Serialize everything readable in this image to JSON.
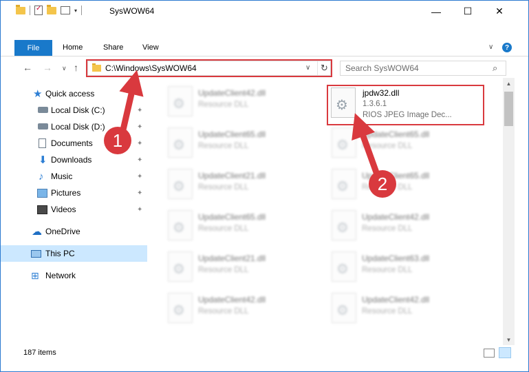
{
  "window": {
    "title": "SysWOW64",
    "controls": {
      "minimize": "—",
      "maximize": "☐",
      "close": "✕"
    }
  },
  "ribbon": {
    "tabs": [
      "File",
      "Home",
      "Share",
      "View"
    ],
    "expand_icon": "chevron-down-icon",
    "help_label": "?"
  },
  "navigation": {
    "back": "←",
    "forward": "→",
    "recent": "∨",
    "up": "↑",
    "address_path": "C:\\Windows\\SysWOW64",
    "refresh": "↻",
    "search_placeholder": "Search SysWOW64",
    "search_icon": "⌕"
  },
  "sidebar": {
    "items": [
      {
        "label": "Quick access",
        "icon": "star-icon",
        "pinned": false
      },
      {
        "label": "Local Disk (C:)",
        "icon": "drive-icon",
        "pinned": true
      },
      {
        "label": "Local Disk (D:)",
        "icon": "drive-icon",
        "pinned": true
      },
      {
        "label": "Documents",
        "icon": "documents-icon",
        "pinned": true
      },
      {
        "label": "Downloads",
        "icon": "download-icon",
        "pinned": true
      },
      {
        "label": "Music",
        "icon": "music-icon",
        "pinned": true
      },
      {
        "label": "Pictures",
        "icon": "pictures-icon",
        "pinned": true
      },
      {
        "label": "Videos",
        "icon": "videos-icon",
        "pinned": true
      },
      {
        "label": "OneDrive",
        "icon": "cloud-icon",
        "pinned": false
      },
      {
        "label": "This PC",
        "icon": "computer-icon",
        "pinned": false,
        "selected": true
      },
      {
        "label": "Network",
        "icon": "network-icon",
        "pinned": false
      }
    ],
    "pin_glyph": "📌"
  },
  "files": {
    "left_column": [
      {
        "name": "UpdateClient42.dll",
        "type": "Resource DLL"
      },
      {
        "name": "UpdateClient65.dll",
        "type": "Resource DLL"
      },
      {
        "name": "UpdateClient21.dll",
        "type": "Resource DLL"
      },
      {
        "name": "UpdateClient65.dll",
        "type": "Resource DLL"
      },
      {
        "name": "UpdateClient21.dll",
        "type": "Resource DLL"
      },
      {
        "name": "UpdateClient42.dll",
        "type": "Resource DLL"
      }
    ],
    "highlighted": {
      "name": "jpdw32.dll",
      "version": "1.3.6.1",
      "description": "RIOS JPEG Image Dec..."
    },
    "right_column": [
      {
        "name": "UpdateClient65.dll",
        "type": "Resource DLL"
      },
      {
        "name": "UpdateClient65.dll",
        "type": "Resource DLL"
      },
      {
        "name": "UpdateClient42.dll",
        "type": "Resource DLL"
      },
      {
        "name": "UpdateClient63.dll",
        "type": "Resource DLL"
      },
      {
        "name": "UpdateClient42.dll",
        "type": "Resource DLL"
      }
    ]
  },
  "status": {
    "item_count": "187 items"
  },
  "annotations": {
    "step1": "1",
    "step2": "2",
    "color": "#d9393e"
  }
}
